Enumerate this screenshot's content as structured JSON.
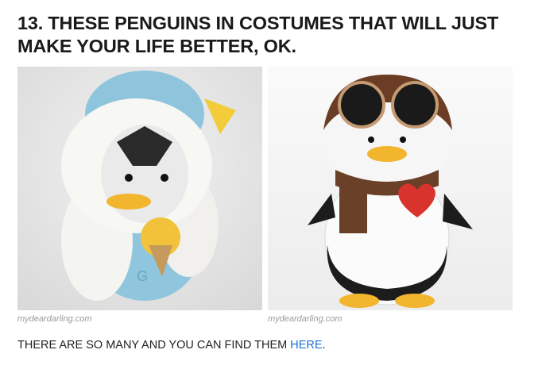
{
  "article": {
    "headline": "13. THESE PENGUINS IN COSTUMES THAT WILL JUST MAKE YOUR LIFE BETTER, OK.",
    "images": [
      {
        "alt": "Penguin plush in a yeti costume holding an ice cream cone",
        "credit": "mydeardarling.com"
      },
      {
        "alt": "Penguin plush in an aviator hat with goggles and a brown scarf",
        "credit": "mydeardarling.com"
      }
    ],
    "caption_prefix": "THERE ARE SO MANY AND YOU CAN FIND THEM ",
    "caption_link": "HERE",
    "caption_suffix": "."
  },
  "colors": {
    "headline": "#1a1a1a",
    "link": "#1a6fd1",
    "credit": "#9a9a9a"
  }
}
